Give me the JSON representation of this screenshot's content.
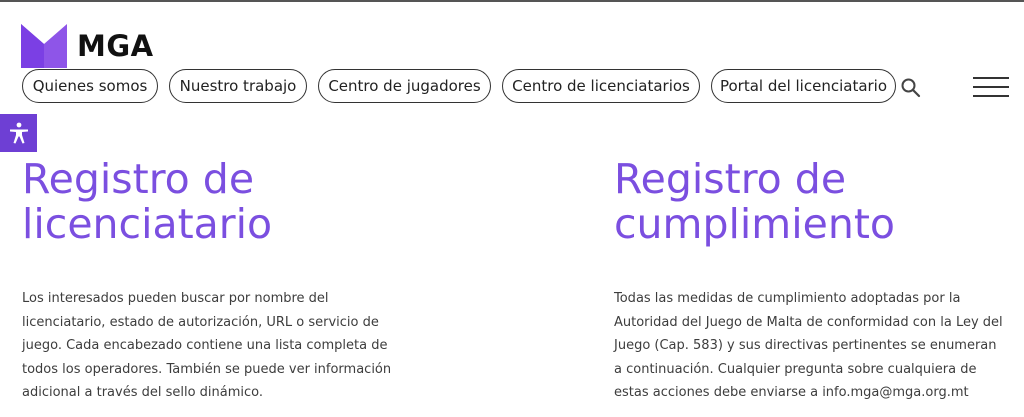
{
  "brand": {
    "name": "MGA",
    "color": "#7b4fe0"
  },
  "nav": {
    "items": [
      {
        "label": "Quienes somos"
      },
      {
        "label": "Nuestro trabajo"
      },
      {
        "label": "Centro de jugadores"
      },
      {
        "label": "Centro de licenciatarios"
      },
      {
        "label": "Portal del licenciatario"
      }
    ],
    "search_icon": "search-icon",
    "menu_icon": "hamburger-menu-icon"
  },
  "accessibility": {
    "icon": "accessibility-icon",
    "color": "#6e3fd4"
  },
  "sections": [
    {
      "title_line1": "Registro de",
      "title_line2": "licenciatario",
      "body": "Los interesados pueden buscar por nombre del licenciatario, estado de autorización, URL o servicio de juego. Cada encabezado contiene una lista completa de todos los operadores. También se puede ver información adicional a través del sello dinámico."
    },
    {
      "title_line1": "Registro de",
      "title_line2": "cumplimiento",
      "body": "Todas las medidas de cumplimiento adoptadas por la Autoridad del Juego de Malta de conformidad con la Ley del Juego (Cap. 583) y sus directivas pertinentes se enumeran a continuación. Cualquier pregunta sobre cualquiera de estas acciones debe enviarse a info.mga@mga.org.mt"
    }
  ]
}
